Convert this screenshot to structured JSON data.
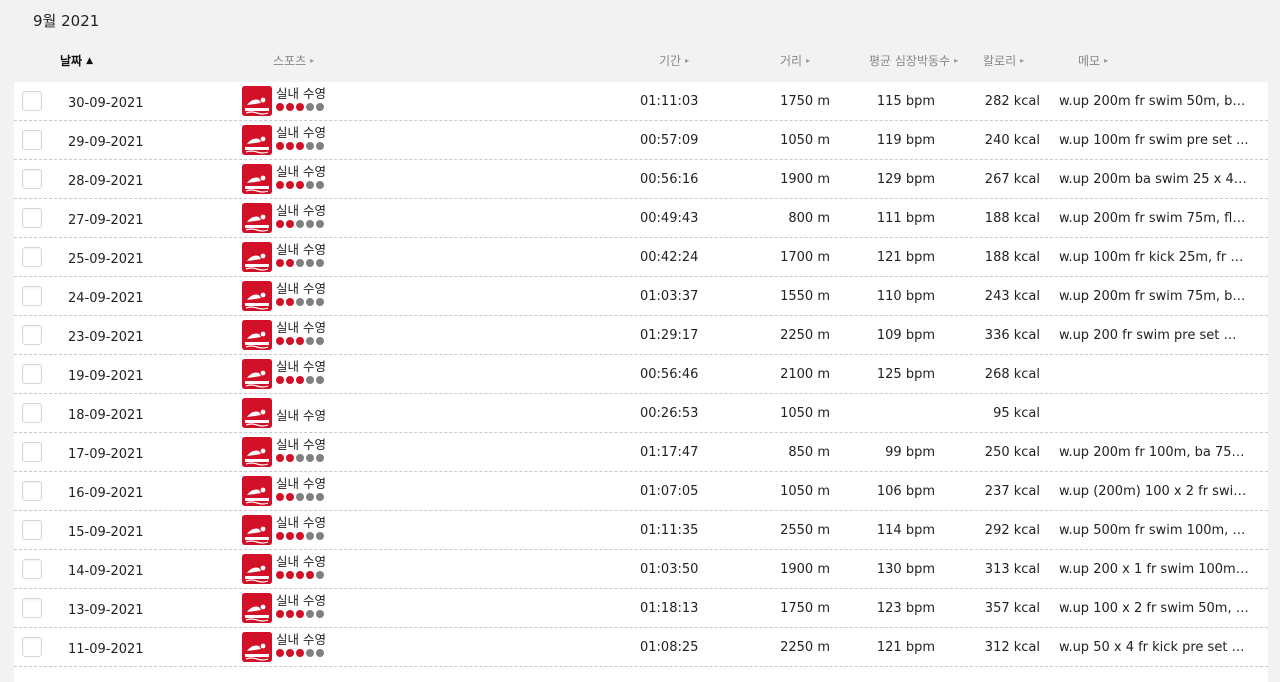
{
  "month_title": "9월 2021",
  "columns": {
    "date": "날짜",
    "date_arrow": "▲",
    "sport": "스포츠",
    "duration": "기간",
    "distance": "거리",
    "avg_hr": "평균 심장박동수",
    "calories": "칼로리",
    "memo": "메모",
    "arrow": "▸"
  },
  "colors": {
    "accent": "#d21027",
    "dot_off": "#808080"
  },
  "sport_icon": "swimming-icon",
  "rows": [
    {
      "date": "30-09-2021",
      "sport": "실내 수영",
      "level": 3,
      "duration": "01:11:03",
      "distance": "1750 m",
      "hr": "115 bpm",
      "cal": "282 kcal",
      "memo": "w.up 200m fr swim 50m, ba ..."
    },
    {
      "date": "29-09-2021",
      "sport": "실내 수영",
      "level": 3,
      "duration": "00:57:09",
      "distance": "1050 m",
      "hr": "119 bpm",
      "cal": "240 kcal",
      "memo": "w.up 100m fr swim  pre set     ..."
    },
    {
      "date": "28-09-2021",
      "sport": "실내 수영",
      "level": 3,
      "duration": "00:56:16",
      "distance": "1900 m",
      "hr": "129 bpm",
      "cal": "267 kcal",
      "memo": "w.up 200m ba swim 25 x 4 o ..."
    },
    {
      "date": "27-09-2021",
      "sport": "실내 수영",
      "level": 2,
      "duration": "00:49:43",
      "distance": "800 m",
      "hr": "111 bpm",
      "cal": "188 kcal",
      "memo": "w.up 200m fr swim 75m, fly  ..."
    },
    {
      "date": "25-09-2021",
      "sport": "실내 수영",
      "level": 2,
      "duration": "00:42:24",
      "distance": "1700 m",
      "hr": "121 bpm",
      "cal": "188 kcal",
      "memo": "w.up 100m fr kick 25m, fr sw..."
    },
    {
      "date": "24-09-2021",
      "sport": "실내 수영",
      "level": 2,
      "duration": "01:03:37",
      "distance": "1550 m",
      "hr": "110 bpm",
      "cal": "243 kcal",
      "memo": "w.up 200m fr swim 75m, ba ..."
    },
    {
      "date": "23-09-2021",
      "sport": "실내 수영",
      "level": 3,
      "duration": "01:29:17",
      "distance": "2250 m",
      "hr": "109 bpm",
      "cal": "336 kcal",
      "memo": "w.up 200 fr swim pre set @ ..."
    },
    {
      "date": "19-09-2021",
      "sport": "실내 수영",
      "level": 3,
      "duration": "00:56:46",
      "distance": "2100 m",
      "hr": "125 bpm",
      "cal": "268 kcal",
      "memo": ""
    },
    {
      "date": "18-09-2021",
      "sport": "실내 수영",
      "level": 0,
      "duration": "00:26:53",
      "distance": "1050 m",
      "hr": "",
      "cal": "95 kcal",
      "memo": ""
    },
    {
      "date": "17-09-2021",
      "sport": "실내 수영",
      "level": 2,
      "duration": "01:17:47",
      "distance": "850 m",
      "hr": "99 bpm",
      "cal": "250 kcal",
      "memo": "w.up 200m fr 100m, ba 75m, ..."
    },
    {
      "date": "16-09-2021",
      "sport": "실내 수영",
      "level": 2,
      "duration": "01:07:05",
      "distance": "1050 m",
      "hr": "106 bpm",
      "cal": "237 kcal",
      "memo": "w.up (200m) 100 x 2 fr swim  ..."
    },
    {
      "date": "15-09-2021",
      "sport": "실내 수영",
      "level": 3,
      "duration": "01:11:35",
      "distance": "2550 m",
      "hr": "114 bpm",
      "cal": "292 kcal",
      "memo": "w.up 500m fr swim 100m, fr  ..."
    },
    {
      "date": "14-09-2021",
      "sport": "실내 수영",
      "level": 4,
      "duration": "01:03:50",
      "distance": "1900 m",
      "hr": "130 bpm",
      "cal": "313 kcal",
      "memo": "w.up 200 x 1 fr swim 100m,  ..."
    },
    {
      "date": "13-09-2021",
      "sport": "실내 수영",
      "level": 3,
      "duration": "01:18:13",
      "distance": "1750 m",
      "hr": "123 bpm",
      "cal": "357 kcal",
      "memo": "w.up 100 x 2 fr swim 50m, b..."
    },
    {
      "date": "11-09-2021",
      "sport": "실내 수영",
      "level": 3,
      "duration": "01:08:25",
      "distance": "2250 m",
      "hr": "121 bpm",
      "cal": "312 kcal",
      "memo": "w.up 50 x 4 fr kick pre set (E..."
    }
  ]
}
